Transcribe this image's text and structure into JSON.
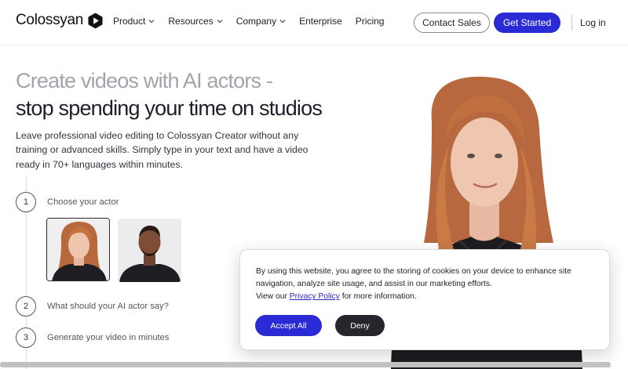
{
  "header": {
    "logo_text": "Colossyan",
    "nav": [
      {
        "label": "Product",
        "has_dropdown": true
      },
      {
        "label": "Resources",
        "has_dropdown": true
      },
      {
        "label": "Company",
        "has_dropdown": true
      },
      {
        "label": "Enterprise",
        "has_dropdown": false
      },
      {
        "label": "Pricing",
        "has_dropdown": false
      }
    ],
    "contact_sales": "Contact Sales",
    "get_started": "Get Started",
    "login": "Log in"
  },
  "hero": {
    "title_line1": "Create videos with AI actors -",
    "title_line2": "stop spending your time on studios",
    "description": "Leave professional video editing to Colossyan Creator without any training or advanced skills. Simply type in your text and have a video ready in 70+ languages within minutes."
  },
  "steps": [
    {
      "number": "1",
      "label": "Choose your actor"
    },
    {
      "number": "2",
      "label": "What should your AI actor say?"
    },
    {
      "number": "3",
      "label": "Generate your video in minutes"
    }
  ],
  "cookie": {
    "text": "By using this website, you agree to the storing of cookies on your device to enhance site navigation, analyze site usage, and assist in our marketing efforts.",
    "view_prefix": "View our ",
    "privacy_link": "Privacy Policy",
    "view_suffix": " for more information.",
    "accept": "Accept All",
    "deny": "Deny"
  },
  "colors": {
    "brand_blue": "#2b2bd6",
    "dark_button": "#26262c",
    "title_gray": "#a3a3ab"
  }
}
